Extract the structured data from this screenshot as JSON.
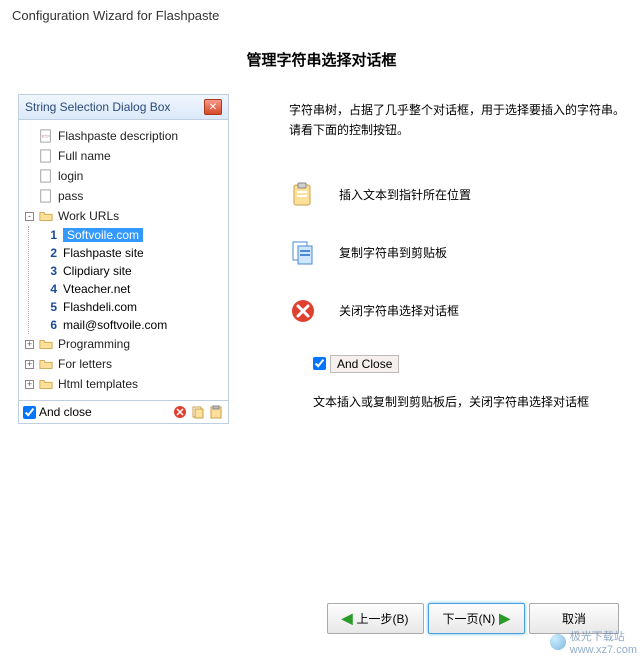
{
  "window": {
    "title": "Configuration Wizard for Flashpaste"
  },
  "section_title": "管理字符串选择对话框",
  "tree": {
    "header": "String Selection Dialog Box",
    "items": [
      {
        "label": "Flashpaste description",
        "icon": "rtf"
      },
      {
        "label": "Full name",
        "icon": "file"
      },
      {
        "label": "login",
        "icon": "file"
      },
      {
        "label": "pass",
        "icon": "file"
      }
    ],
    "work_urls_label": "Work URLs",
    "work_urls": [
      {
        "num": "1",
        "label": "Softvoile.com",
        "selected": true
      },
      {
        "num": "2",
        "label": "Flashpaste site"
      },
      {
        "num": "3",
        "label": "Clipdiary site"
      },
      {
        "num": "4",
        "label": "Vteacher.net"
      },
      {
        "num": "5",
        "label": "Flashdeli.com"
      },
      {
        "num": "6",
        "label": "mail@softvoile.com"
      }
    ],
    "folders": [
      {
        "label": "Programming"
      },
      {
        "label": "For letters"
      },
      {
        "label": "Html templates"
      }
    ],
    "footer_label": "And close"
  },
  "right": {
    "description": "字符串树，占据了几乎整个对话框，用于选择要插入的字符串。请看下面的控制按钮。",
    "actions": [
      {
        "key": "paste",
        "label": "插入文本到指针所在位置"
      },
      {
        "key": "copy",
        "label": "复制字符串到剪贴板"
      },
      {
        "key": "close",
        "label": "关闭字符串选择对话框"
      }
    ],
    "and_close": "And Close",
    "bottom_note": "文本插入或复制到剪贴板后，关闭字符串选择对话框"
  },
  "buttons": {
    "back": "上一步(B)",
    "next": "下一页(N)",
    "cancel": "取消"
  },
  "watermark": {
    "text": "极光下载站",
    "url": "www.xz7.com"
  }
}
